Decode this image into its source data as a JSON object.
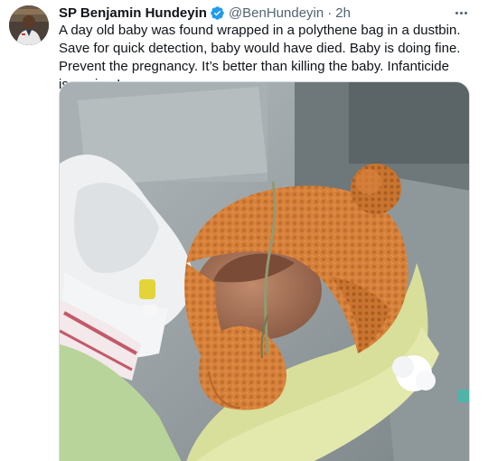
{
  "author": {
    "display_name": "SP Benjamin Hundeyin",
    "handle": "@BenHundeyin",
    "separator": "·",
    "time": "2h",
    "verified_color": "#1d9bf0"
  },
  "tweet": {
    "text": "A day old baby was found wrapped in a polythene bag in a dustbin. Save for quick detection, baby would have died. Baby is doing fine. Prevent the pregnancy. It’s better than killing the baby. Infanticide is a crime!"
  },
  "icons": {
    "verified": "verified-badge-icon",
    "more": "more-options-icon"
  },
  "colors": {
    "text": "#0f1419",
    "secondary": "#536471",
    "knit": "#d9823f"
  }
}
